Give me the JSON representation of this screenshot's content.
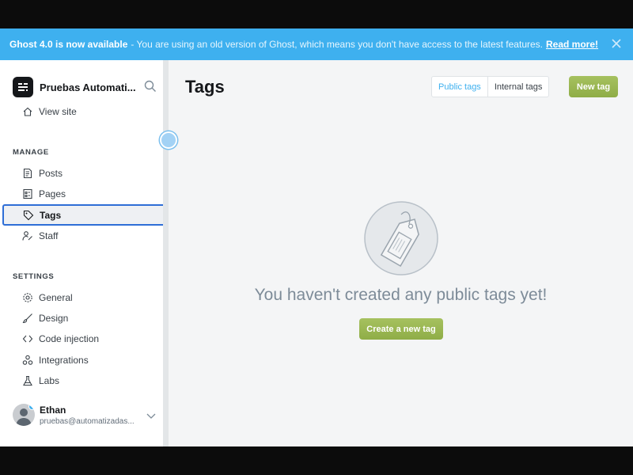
{
  "banner": {
    "title": "Ghost 4.0 is now available",
    "message": "- You are using an old version of Ghost, which means you don't have access to the latest features.",
    "link": "Read more!",
    "close_icon": "close-icon"
  },
  "sidebar": {
    "site_name": "Pruebas Automati...",
    "view_site": "View site",
    "manage_label": "MANAGE",
    "manage_items": [
      {
        "label": "Posts",
        "icon": "posts-icon"
      },
      {
        "label": "Pages",
        "icon": "pages-icon"
      },
      {
        "label": "Tags",
        "icon": "tag-icon"
      },
      {
        "label": "Staff",
        "icon": "staff-icon"
      }
    ],
    "settings_label": "SETTINGS",
    "settings_items": [
      {
        "label": "General",
        "icon": "gear-icon"
      },
      {
        "label": "Design",
        "icon": "brush-icon"
      },
      {
        "label": "Code injection",
        "icon": "code-icon"
      },
      {
        "label": "Integrations",
        "icon": "integrations-icon"
      },
      {
        "label": "Labs",
        "icon": "flask-icon"
      }
    ],
    "user": {
      "name": "Ethan",
      "email": "pruebas@automatizadas..."
    }
  },
  "main": {
    "title": "Tags",
    "tabs": [
      "Public tags",
      "Internal tags"
    ],
    "active_tab": "Public tags",
    "new_button": "New tag",
    "empty_message": "You haven't created any public tags yet!",
    "create_button": "Create a new tag"
  },
  "colors": {
    "banner": "#3eb0ef",
    "accent_green": "#9fbb58",
    "active_border": "#2e6ed6"
  }
}
